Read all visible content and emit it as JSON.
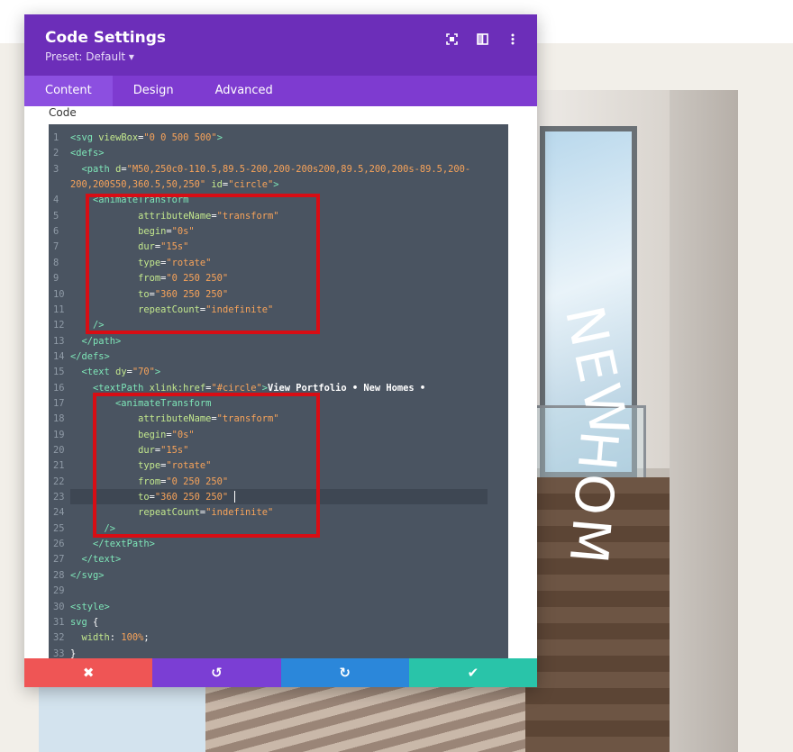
{
  "modal": {
    "title": "Code Settings",
    "preset": "Preset: Default ▾",
    "icons": [
      "fullscreen-icon",
      "split-view-icon",
      "more-icon"
    ]
  },
  "tabs": [
    {
      "label": "Content",
      "active": true
    },
    {
      "label": "Design",
      "active": false
    },
    {
      "label": "Advanced",
      "active": false
    }
  ],
  "field_label": "Code",
  "code_lines": [
    {
      "n": "1",
      "html": "<span class='t'>&lt;svg</span> <span class='a'>viewBox</span>=<span class='s'>\"0 0 500 500\"</span><span class='t'>&gt;</span>"
    },
    {
      "n": "2",
      "html": "<span class='t'>&lt;defs&gt;</span>"
    },
    {
      "n": "3",
      "html": "  <span class='t'>&lt;path</span> <span class='a'>d</span>=<span class='s'>\"M50,250c0-110.5,89.5-200,200-200s200,89.5,200,200s-89.5,200-</span>"
    },
    {
      "n": "",
      "html": "<span class='s'>200,200S50,360.5,50,250\"</span> <span class='a'>id</span>=<span class='s'>\"circle\"</span><span class='t'>&gt;</span>"
    },
    {
      "n": "4",
      "html": "    <span class='t'>&lt;animateTransform</span>"
    },
    {
      "n": "5",
      "html": "            <span class='a'>attributeName</span>=<span class='s'>\"transform\"</span>"
    },
    {
      "n": "6",
      "html": "            <span class='a'>begin</span>=<span class='s'>\"0s\"</span>"
    },
    {
      "n": "7",
      "html": "            <span class='a'>dur</span>=<span class='s'>\"15s\"</span>"
    },
    {
      "n": "8",
      "html": "            <span class='a'>type</span>=<span class='s'>\"rotate\"</span>"
    },
    {
      "n": "9",
      "html": "            <span class='a'>from</span>=<span class='s'>\"0 250 250\"</span>"
    },
    {
      "n": "10",
      "html": "            <span class='a'>to</span>=<span class='s'>\"360 250 250\"</span>"
    },
    {
      "n": "11",
      "html": "            <span class='a'>repeatCount</span>=<span class='s'>\"indefinite\"</span>"
    },
    {
      "n": "12",
      "html": "    <span class='t'>/&gt;</span>"
    },
    {
      "n": "13",
      "html": "  <span class='t'>&lt;/path&gt;</span>"
    },
    {
      "n": "14",
      "html": "<span class='t'>&lt;/defs&gt;</span>"
    },
    {
      "n": "15",
      "html": "  <span class='t'>&lt;text</span> <span class='a'>dy</span>=<span class='s'>\"70\"</span><span class='t'>&gt;</span>"
    },
    {
      "n": "16",
      "html": "    <span class='t'>&lt;textPath</span> <span class='a'>xlink:href</span>=<span class='s'>\"#circle\"</span><span class='t'>&gt;</span><span class='w'>View Portfolio • New Homes •</span>"
    },
    {
      "n": "17",
      "html": "        <span class='t'>&lt;animateTransform</span>"
    },
    {
      "n": "18",
      "html": "            <span class='a'>attributeName</span>=<span class='s'>\"transform\"</span>"
    },
    {
      "n": "19",
      "html": "            <span class='a'>begin</span>=<span class='s'>\"0s\"</span>"
    },
    {
      "n": "20",
      "html": "            <span class='a'>dur</span>=<span class='s'>\"15s\"</span>"
    },
    {
      "n": "21",
      "html": "            <span class='a'>type</span>=<span class='s'>\"rotate\"</span>"
    },
    {
      "n": "22",
      "html": "            <span class='a'>from</span>=<span class='s'>\"0 250 250\"</span>"
    },
    {
      "n": "23",
      "html": "            <span class='a'>to</span>=<span class='s'>\"360 250 250\"</span>"
    },
    {
      "n": "24",
      "html": "            <span class='a'>repeatCount</span>=<span class='s'>\"indefinite\"</span>"
    },
    {
      "n": "25",
      "html": "      <span class='t'>/&gt;</span>"
    },
    {
      "n": "26",
      "html": "    <span class='t'>&lt;/textPath&gt;</span>"
    },
    {
      "n": "27",
      "html": "  <span class='t'>&lt;/text&gt;</span>"
    },
    {
      "n": "28",
      "html": "<span class='t'>&lt;/svg&gt;</span>"
    },
    {
      "n": "29",
      "html": ""
    },
    {
      "n": "30",
      "html": "<span class='t'>&lt;style&gt;</span>"
    },
    {
      "n": "31",
      "html": "<span class='t'>svg</span> {"
    },
    {
      "n": "32",
      "html": "  <span class='a'>width</span>: <span class='s'>100%</span>;"
    },
    {
      "n": "33",
      "html": "}"
    }
  ],
  "background_text": [
    "NEW",
    "HOM"
  ],
  "footer": [
    {
      "name": "discard-button",
      "icon": "✖",
      "color": "#ef5555"
    },
    {
      "name": "undo-button",
      "icon": "↺",
      "color": "#7b3ed4"
    },
    {
      "name": "redo-button",
      "icon": "↻",
      "color": "#2b87da"
    },
    {
      "name": "save-button",
      "icon": "✔",
      "color": "#29c4a9"
    }
  ]
}
